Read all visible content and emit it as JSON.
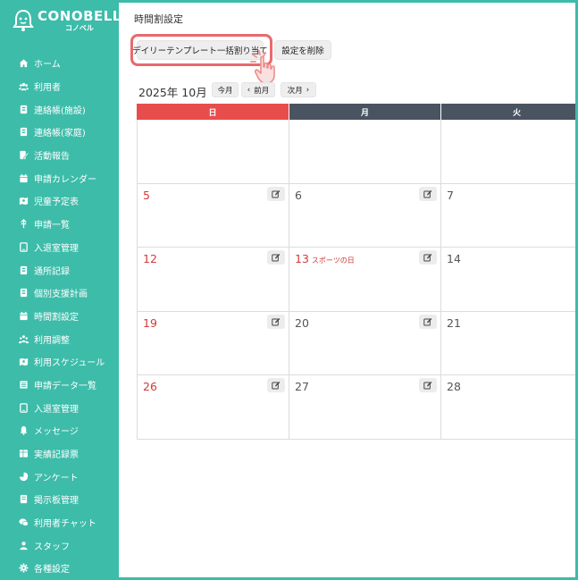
{
  "app": {
    "logo_main": "CONOBELL",
    "logo_sub": "コノベル"
  },
  "sidebar": {
    "items": [
      {
        "label": "ホーム",
        "icon": "home-icon"
      },
      {
        "label": "利用者",
        "icon": "users-icon"
      },
      {
        "label": "連絡帳(施設)",
        "icon": "notebook-icon"
      },
      {
        "label": "連絡帳(家庭)",
        "icon": "notebook-icon"
      },
      {
        "label": "活動報告",
        "icon": "report-icon"
      },
      {
        "label": "申請カレンダー",
        "icon": "calendar-icon"
      },
      {
        "label": "児童予定表",
        "icon": "schedule-icon"
      },
      {
        "label": "申請一覧",
        "icon": "request-icon"
      },
      {
        "label": "入退室管理",
        "icon": "tablet-icon"
      },
      {
        "label": "通所記録",
        "icon": "notebook-icon"
      },
      {
        "label": "個別支援計画",
        "icon": "notebook-icon"
      },
      {
        "label": "時間割設定",
        "icon": "calendar-icon"
      },
      {
        "label": "利用調整",
        "icon": "group-icon"
      },
      {
        "label": "利用スケジュール",
        "icon": "schedule-icon"
      },
      {
        "label": "申請データ一覧",
        "icon": "list-icon"
      },
      {
        "label": "入退室管理",
        "icon": "tablet-icon"
      },
      {
        "label": "メッセージ",
        "icon": "bell-icon"
      },
      {
        "label": "実績記録票",
        "icon": "record-icon"
      },
      {
        "label": "アンケート",
        "icon": "pie-icon"
      },
      {
        "label": "掲示板管理",
        "icon": "board-icon"
      },
      {
        "label": "利用者チャット",
        "icon": "chat-icon"
      },
      {
        "label": "スタッフ",
        "icon": "staff-icon"
      },
      {
        "label": "各種設定",
        "icon": "gear-icon"
      }
    ]
  },
  "main": {
    "title": "時間割設定",
    "assign_button": "デイリーテンプレート一括割り当て",
    "delete_button": "設定を削除",
    "month_label": "2025年 10月",
    "today_button": "今月",
    "prev_button": "前月",
    "next_button": "次月"
  },
  "calendar": {
    "headers": [
      "日",
      "月",
      "火"
    ],
    "rows": [
      [
        {
          "day": ""
        },
        {
          "day": ""
        },
        {
          "day": ""
        }
      ],
      [
        {
          "day": "5",
          "red": true
        },
        {
          "day": "6"
        },
        {
          "day": "7"
        }
      ],
      [
        {
          "day": "12",
          "red": true
        },
        {
          "day": "13",
          "red": true,
          "holiday": "スポーツの日"
        },
        {
          "day": "14"
        }
      ],
      [
        {
          "day": "19",
          "red": true
        },
        {
          "day": "20"
        },
        {
          "day": "21"
        }
      ],
      [
        {
          "day": "26",
          "red": true
        },
        {
          "day": "27"
        },
        {
          "day": "28"
        }
      ]
    ]
  },
  "colors": {
    "sidebar": "#3dbcaa",
    "sunday_header": "#e84d4d",
    "weekday_header": "#4a5360",
    "holiday_text": "#d23a3a",
    "highlight": "#e86a6e"
  }
}
